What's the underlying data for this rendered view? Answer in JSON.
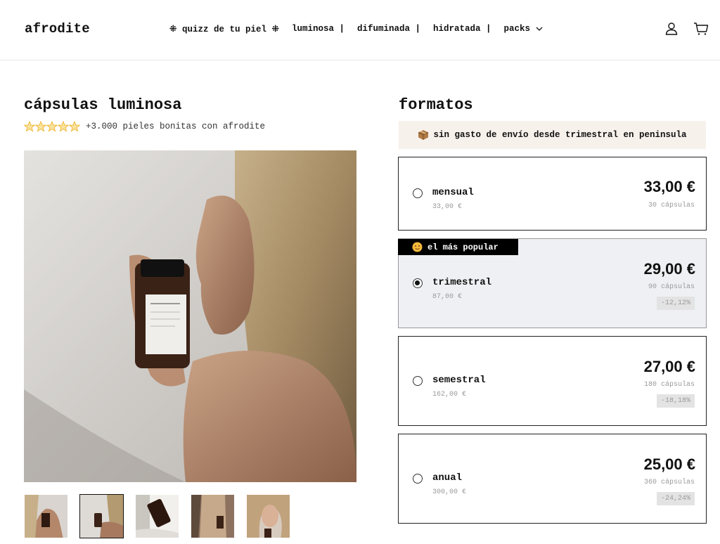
{
  "header": {
    "logo": "afrodite",
    "nav": [
      {
        "label": "⁜ quizz de tu piel ⁜"
      },
      {
        "label": "luminosa |"
      },
      {
        "label": "difuminada |"
      },
      {
        "label": "hidratada |"
      },
      {
        "label": "packs"
      }
    ]
  },
  "product": {
    "title": "cápsulas luminosa",
    "rating_text": "+3.000 pieles bonitas con afrodite",
    "stars": 5
  },
  "formats": {
    "title": "formatos",
    "shipping_text": "sin gasto de envío desde trimestral en peninsula",
    "popular_badge": "el más popular",
    "options": [
      {
        "name": "mensual",
        "sub": "33,00 €",
        "price": "33,00 €",
        "count": "30 cápsulas",
        "discount": ""
      },
      {
        "name": "trimestral",
        "sub": "87,00 €",
        "price": "29,00 €",
        "count": "90 cápsulas",
        "discount": "-12,12%"
      },
      {
        "name": "semestral",
        "sub": "162,00 €",
        "price": "27,00 €",
        "count": "180 cápsulas",
        "discount": "-18,18%"
      },
      {
        "name": "anual",
        "sub": "300,00 €",
        "price": "25,00 €",
        "count": "360 cápsulas",
        "discount": "-24,24%"
      }
    ],
    "selected": "trimestral"
  },
  "colors": {
    "accent": "#000000",
    "star": "#f0b93a",
    "shipping_bg": "#f7f1ec",
    "selected_bg": "#eef0f3"
  }
}
